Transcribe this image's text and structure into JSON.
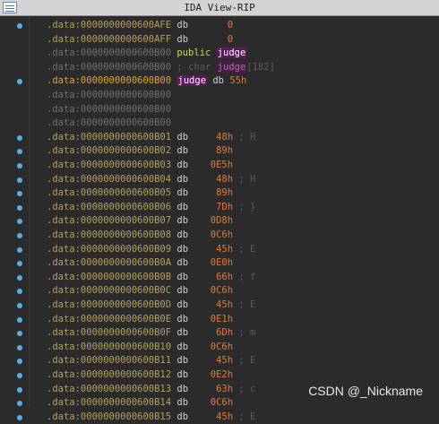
{
  "window": {
    "title": "IDA View-RIP",
    "icon": "listing-icon"
  },
  "watermark": "CSDN @_Nickname",
  "lines": [
    {
      "addr": ".data:0000000000600AFE",
      "op": "db",
      "val": "0",
      "cmt": "",
      "style": "normal",
      "bp": true
    },
    {
      "addr": ".data:0000000000600AFF",
      "op": "db",
      "val": "0",
      "cmt": "",
      "style": "normal",
      "bp": false
    },
    {
      "addr": ".data:0000000000600B00",
      "op": "public",
      "val": "judge",
      "cmt": "",
      "style": "public",
      "bp": false
    },
    {
      "addr": ".data:0000000000600B00",
      "op": "; char",
      "val": "judge",
      "cmt": "[182]",
      "style": "comment-decl",
      "bp": false
    },
    {
      "addr": ".data:0000000000600B00",
      "op": "judge",
      "val": "55h",
      "cmt": "",
      "style": "current",
      "bp": true
    },
    {
      "addr": ".data:0000000000600B00",
      "op": "",
      "val": "",
      "cmt": "",
      "style": "dim",
      "bp": false
    },
    {
      "addr": ".data:0000000000600B00",
      "op": "",
      "val": "",
      "cmt": "",
      "style": "dim",
      "bp": false
    },
    {
      "addr": ".data:0000000000600B00",
      "op": "",
      "val": "",
      "cmt": "",
      "style": "dim",
      "bp": false
    },
    {
      "addr": ".data:0000000000600B01",
      "op": "db",
      "val": "48h",
      "cmt": "; H",
      "style": "normal",
      "bp": true
    },
    {
      "addr": ".data:0000000000600B02",
      "op": "db",
      "val": "89h",
      "cmt": "",
      "style": "normal",
      "bp": true
    },
    {
      "addr": ".data:0000000000600B03",
      "op": "db",
      "val": "0E5h",
      "cmt": "",
      "style": "normal",
      "bp": true
    },
    {
      "addr": ".data:0000000000600B04",
      "op": "db",
      "val": "48h",
      "cmt": "; H",
      "style": "normal",
      "bp": true
    },
    {
      "addr": ".data:0000000000600B05",
      "op": "db",
      "val": "89h",
      "cmt": "",
      "style": "normal",
      "bp": true
    },
    {
      "addr": ".data:0000000000600B06",
      "op": "db",
      "val": "7Dh",
      "cmt": "; }",
      "style": "normal",
      "bp": true
    },
    {
      "addr": ".data:0000000000600B07",
      "op": "db",
      "val": "0D8h",
      "cmt": "",
      "style": "normal",
      "bp": true
    },
    {
      "addr": ".data:0000000000600B08",
      "op": "db",
      "val": "0C6h",
      "cmt": "",
      "style": "normal",
      "bp": true
    },
    {
      "addr": ".data:0000000000600B09",
      "op": "db",
      "val": "45h",
      "cmt": "; E",
      "style": "normal",
      "bp": true
    },
    {
      "addr": ".data:0000000000600B0A",
      "op": "db",
      "val": "0E0h",
      "cmt": "",
      "style": "normal",
      "bp": true
    },
    {
      "addr": ".data:0000000000600B0B",
      "op": "db",
      "val": "66h",
      "cmt": "; f",
      "style": "normal",
      "bp": true
    },
    {
      "addr": ".data:0000000000600B0C",
      "op": "db",
      "val": "0C6h",
      "cmt": "",
      "style": "normal",
      "bp": true
    },
    {
      "addr": ".data:0000000000600B0D",
      "op": "db",
      "val": "45h",
      "cmt": "; E",
      "style": "normal",
      "bp": true
    },
    {
      "addr": ".data:0000000000600B0E",
      "op": "db",
      "val": "0E1h",
      "cmt": "",
      "style": "normal",
      "bp": true
    },
    {
      "addr": ".data:0000000000600B0F",
      "op": "db",
      "val": "6Dh",
      "cmt": "; m",
      "style": "normal",
      "bp": true
    },
    {
      "addr": ".data:0000000000600B10",
      "op": "db",
      "val": "0C6h",
      "cmt": "",
      "style": "normal",
      "bp": true
    },
    {
      "addr": ".data:0000000000600B11",
      "op": "db",
      "val": "45h",
      "cmt": "; E",
      "style": "normal",
      "bp": true
    },
    {
      "addr": ".data:0000000000600B12",
      "op": "db",
      "val": "0E2h",
      "cmt": "",
      "style": "normal",
      "bp": true
    },
    {
      "addr": ".data:0000000000600B13",
      "op": "db",
      "val": "63h",
      "cmt": "; c",
      "style": "normal",
      "bp": true
    },
    {
      "addr": ".data:0000000000600B14",
      "op": "db",
      "val": "0C6h",
      "cmt": "",
      "style": "normal",
      "bp": true
    },
    {
      "addr": ".data:0000000000600B15",
      "op": "db",
      "val": "45h",
      "cmt": "; E",
      "style": "normal",
      "bp": true
    }
  ]
}
